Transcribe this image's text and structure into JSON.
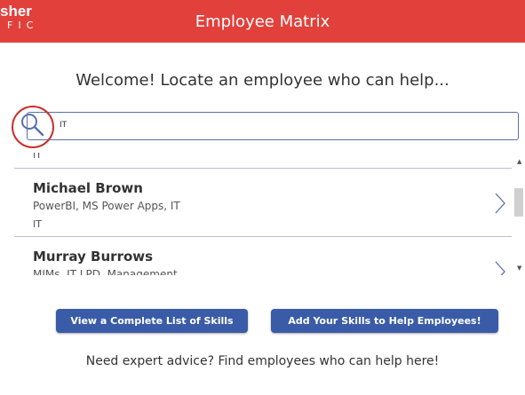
{
  "header": {
    "logo_line1": "sher",
    "logo_line2": "FIC",
    "title": "Employee Matrix",
    "background_color": "#e2403b"
  },
  "welcome_text": "Welcome! Locate an employee who can help...",
  "search": {
    "value": "IT",
    "icon": "search-icon"
  },
  "results": {
    "partial_top_dept": "IT",
    "items": [
      {
        "name": "Michael Brown",
        "skills": "PowerBI, MS Power Apps, IT",
        "dept": "IT"
      },
      {
        "name": "Murray Burrows",
        "skills": "MIMs, IT LPD, Management",
        "dept": ""
      }
    ]
  },
  "buttons": {
    "complete_list": "View a Complete List of Skills",
    "add_skills": "Add Your Skills to Help Employees!",
    "color": "#3a5ca8"
  },
  "footer_text": "Need expert advice? Find employees who can help here!"
}
